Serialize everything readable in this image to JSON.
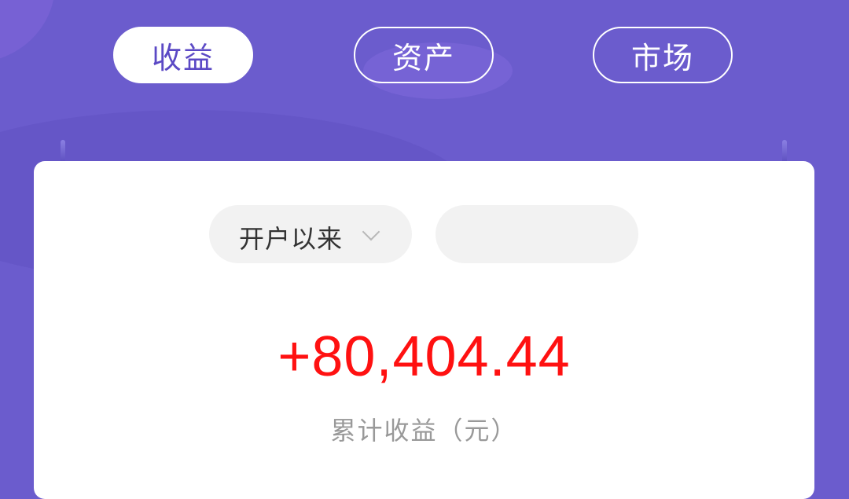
{
  "tabs": [
    {
      "label": "收益",
      "active": true
    },
    {
      "label": "资产",
      "active": false
    },
    {
      "label": "市场",
      "active": false
    }
  ],
  "filter": {
    "period_label": "开户以来",
    "secondary_value": ""
  },
  "summary": {
    "amount": "+80,404.44",
    "amount_label": "累计收益（元）"
  },
  "colors": {
    "background": "#6b5ccd",
    "active_tab_text": "#5b49c5",
    "amount": "#ff1111",
    "muted_text": "#999999"
  },
  "icons": {
    "dropdown": "chevron-down-icon"
  }
}
